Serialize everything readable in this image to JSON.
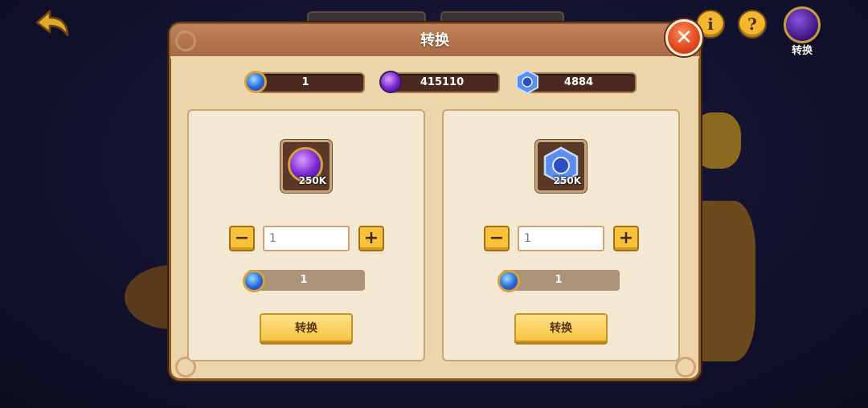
{
  "panel": {
    "title": "转换"
  },
  "corner": {
    "label": "转换"
  },
  "currencies": [
    {
      "icon": "blue-orb-icon",
      "value": "1"
    },
    {
      "icon": "purple-orb-icon",
      "value": "415110"
    },
    {
      "icon": "blue-crystal-icon",
      "value": "4884"
    }
  ],
  "cards": [
    {
      "icon": "purple-orb-icon",
      "amount": "250K",
      "minus": "−",
      "plus": "+",
      "quantity": "1",
      "cost_icon": "blue-orb-icon",
      "cost": "1",
      "button": "转换"
    },
    {
      "icon": "blue-crystal-icon",
      "amount": "250K",
      "minus": "−",
      "plus": "+",
      "quantity": "1",
      "cost_icon": "blue-orb-icon",
      "cost": "1",
      "button": "转换"
    }
  ],
  "header_buttons": {
    "info": "i",
    "help": "?"
  },
  "colors": {
    "panel": "#ecd5a8",
    "title_bar": "#b57550",
    "accent_button": "#f6c542",
    "close": "#e0461e"
  }
}
